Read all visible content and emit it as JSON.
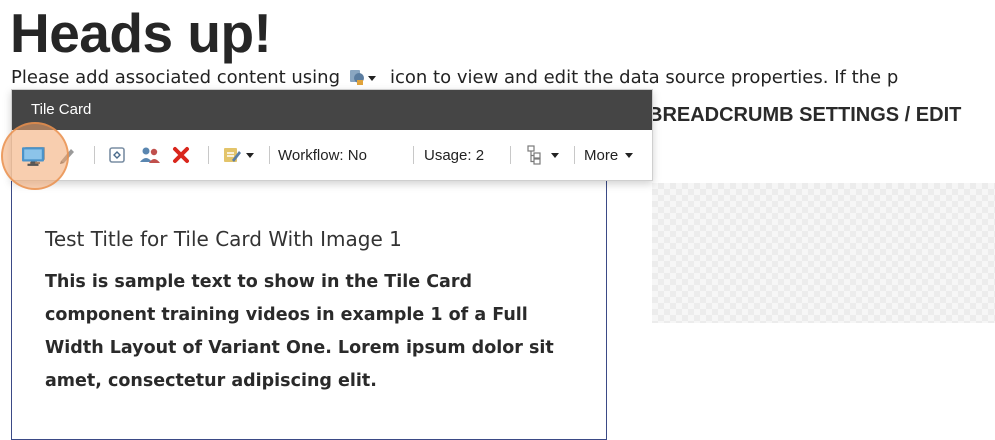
{
  "page": {
    "heading": "Heads up!",
    "instruction_before": "Please add associated content using",
    "instruction_after": "icon to view and edit the data source properties. If the p",
    "instruction_icon": "datasource-properties-icon",
    "breadcrumb_heading": "BREADCRUMB SETTINGS / EDIT"
  },
  "popup": {
    "title": "Tile Card",
    "toolbar": {
      "tools": [
        {
          "name": "preview-icon"
        },
        {
          "name": "edit-pencil-icon"
        },
        {
          "name": "select-datasource-icon"
        },
        {
          "name": "personalize-icon"
        },
        {
          "name": "delete-icon"
        },
        {
          "name": "edit-properties-icon"
        }
      ],
      "workflow_label": "Workflow: No",
      "usage_label": "Usage: 2",
      "hierarchy_icon": "tree-hierarchy-icon",
      "more_label": "More"
    }
  },
  "tile": {
    "title": "Test Title for Tile Card With Image 1",
    "text_lines": [
      "This is sample text to show in the Tile Card",
      "component training videos in example 1 of a Full",
      "Width Layout of Variant One. Lorem ipsum dolor sit",
      "amet, consectetur adipiscing elit."
    ]
  },
  "colors": {
    "toolbar_header": "#454545",
    "tile_border": "#3b4a86",
    "highlight": "#f3a66d",
    "delete_red": "#d9261c"
  }
}
